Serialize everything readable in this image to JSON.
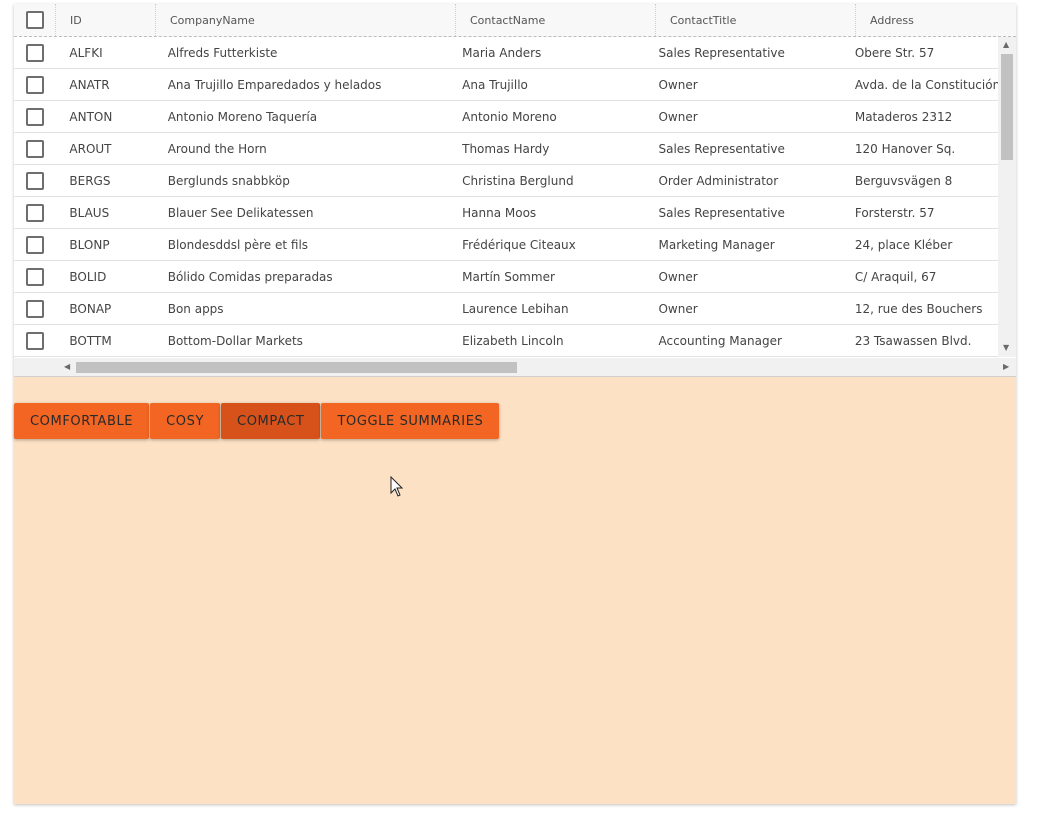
{
  "grid": {
    "columns": [
      "ID",
      "CompanyName",
      "ContactName",
      "ContactTitle",
      "Address"
    ],
    "rows": [
      {
        "id": "ALFKI",
        "company": "Alfreds Futterkiste",
        "contact": "Maria Anders",
        "title": "Sales Representative",
        "address": "Obere Str. 57"
      },
      {
        "id": "ANATR",
        "company": "Ana Trujillo Emparedados y helados",
        "contact": "Ana Trujillo",
        "title": "Owner",
        "address": "Avda. de la Constitución"
      },
      {
        "id": "ANTON",
        "company": "Antonio Moreno Taquería",
        "contact": "Antonio Moreno",
        "title": "Owner",
        "address": "Mataderos 2312"
      },
      {
        "id": "AROUT",
        "company": "Around the Horn",
        "contact": "Thomas Hardy",
        "title": "Sales Representative",
        "address": "120 Hanover Sq."
      },
      {
        "id": "BERGS",
        "company": "Berglunds snabbköp",
        "contact": "Christina Berglund",
        "title": "Order Administrator",
        "address": "Berguvsvägen 8"
      },
      {
        "id": "BLAUS",
        "company": "Blauer See Delikatessen",
        "contact": "Hanna Moos",
        "title": "Sales Representative",
        "address": "Forsterstr. 57"
      },
      {
        "id": "BLONP",
        "company": "Blondesddsl père et fils",
        "contact": "Frédérique Citeaux",
        "title": "Marketing Manager",
        "address": "24, place Kléber"
      },
      {
        "id": "BOLID",
        "company": "Bólido Comidas preparadas",
        "contact": "Martín Sommer",
        "title": "Owner",
        "address": "C/ Araquil, 67"
      },
      {
        "id": "BONAP",
        "company": "Bon apps",
        "contact": "Laurence Lebihan",
        "title": "Owner",
        "address": "12, rue des Bouchers"
      },
      {
        "id": "BOTTM",
        "company": "Bottom-Dollar Markets",
        "contact": "Elizabeth Lincoln",
        "title": "Accounting Manager",
        "address": "23 Tsawassen Blvd."
      }
    ]
  },
  "buttons": {
    "comfortable": "COMFORTABLE",
    "cosy": "COSY",
    "compact": "COMPACT",
    "toggle_summaries": "TOGGLE SUMMARIES"
  },
  "colors": {
    "accent": "#f26522",
    "accent_active": "#d6521a",
    "panel_bg": "#fce1c5"
  }
}
